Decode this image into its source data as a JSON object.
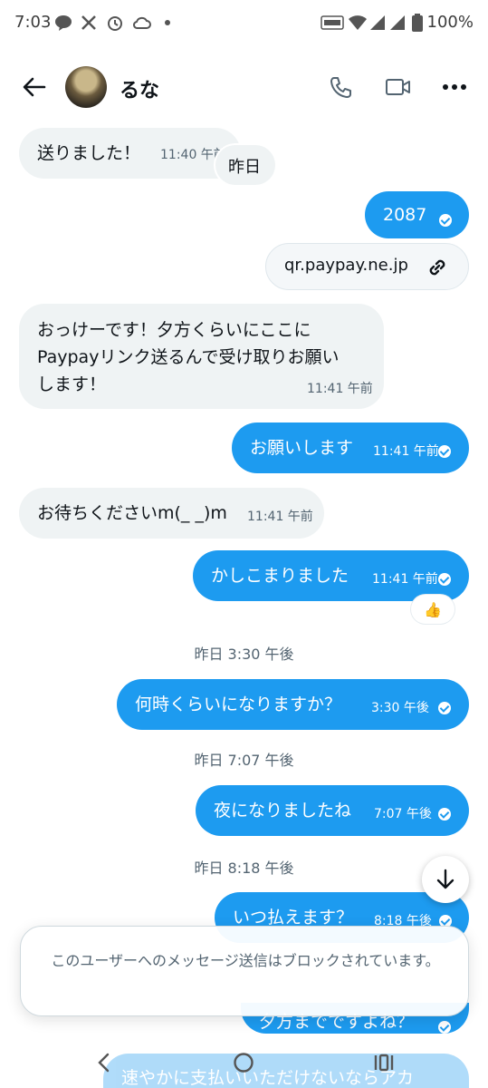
{
  "status_bar": {
    "time": "7:03",
    "battery": "100%",
    "left_icons": [
      "line-icon",
      "x-icon",
      "alarm-icon",
      "cloud-icon",
      "dot-icon"
    ],
    "right_icons": [
      "volte-icon",
      "wifi-icon",
      "signal-icon",
      "signal-icon",
      "battery-icon"
    ]
  },
  "header": {
    "name": "るな",
    "back_icon": "arrow-left-icon",
    "call_icon": "phone-icon",
    "video_icon": "video-icon",
    "more_icon": "more-icon"
  },
  "messages": {
    "m1": {
      "text": "送りました！",
      "time": "11:40 午前"
    },
    "yesterday_chip": "昨日",
    "m2": {
      "text": "2087"
    },
    "link": {
      "text": "qr.paypay.ne.jp",
      "icon": "link-icon"
    },
    "m3": {
      "line1": "おっけーです！夕方くらいにここに",
      "line2": "Paypayリンク送るんで受け取りお願い",
      "line3": "します！",
      "time": "11:41 午前"
    },
    "m4": {
      "text": "お願いします",
      "time": "11:41 午前"
    },
    "m5": {
      "text": "お待ちくださいm(_ _)m",
      "time": "11:41 午前"
    },
    "m6": {
      "text": "かしこまりました",
      "time": "11:41 午前",
      "reaction": "👍"
    },
    "div1": "昨日 3:30 午後",
    "m7": {
      "text": "何時くらいになりますか？",
      "time": "3:30 午後"
    },
    "div2": "昨日 7:07 午後",
    "m8": {
      "text": "夜になりましたね",
      "time": "7:07 午後"
    },
    "div3": "昨日 8:18 午後",
    "m9": {
      "text": "いつ払えます？",
      "time": "8:18 午後"
    },
    "m10": {
      "text": "夕方までですよね？"
    },
    "m11": {
      "text": "速やかに支払いいただけないならアカ"
    }
  },
  "blocked_notice": "このユーザーへのメッセージ送信はブロックされています。",
  "nav_bar": {
    "back_icon": "nav-back-icon",
    "home_icon": "nav-home-icon",
    "recents_icon": "nav-recents-icon"
  },
  "colors": {
    "sent_bubble": "#1d9bf0",
    "received_bubble": "#eff3f4",
    "secondary_text": "#536471"
  }
}
